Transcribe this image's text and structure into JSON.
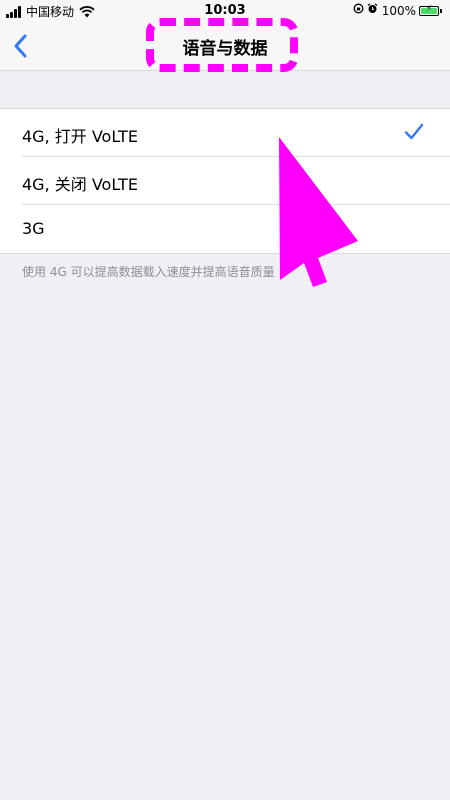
{
  "status_bar": {
    "carrier": "中国移动",
    "time": "10:03",
    "battery_percent": "100%",
    "battery_level": 1.0
  },
  "nav": {
    "title": "语音与数据"
  },
  "options": [
    {
      "label": "4G, 打开 VoLTE",
      "selected": true
    },
    {
      "label": "4G, 关闭 VoLTE",
      "selected": false
    },
    {
      "label": "3G",
      "selected": false
    }
  ],
  "footer_note": "使用 4G 可以提高数据载入速度并提高语音质量",
  "colors": {
    "accent": "#3478f6",
    "annotation": "#ff00ff"
  }
}
